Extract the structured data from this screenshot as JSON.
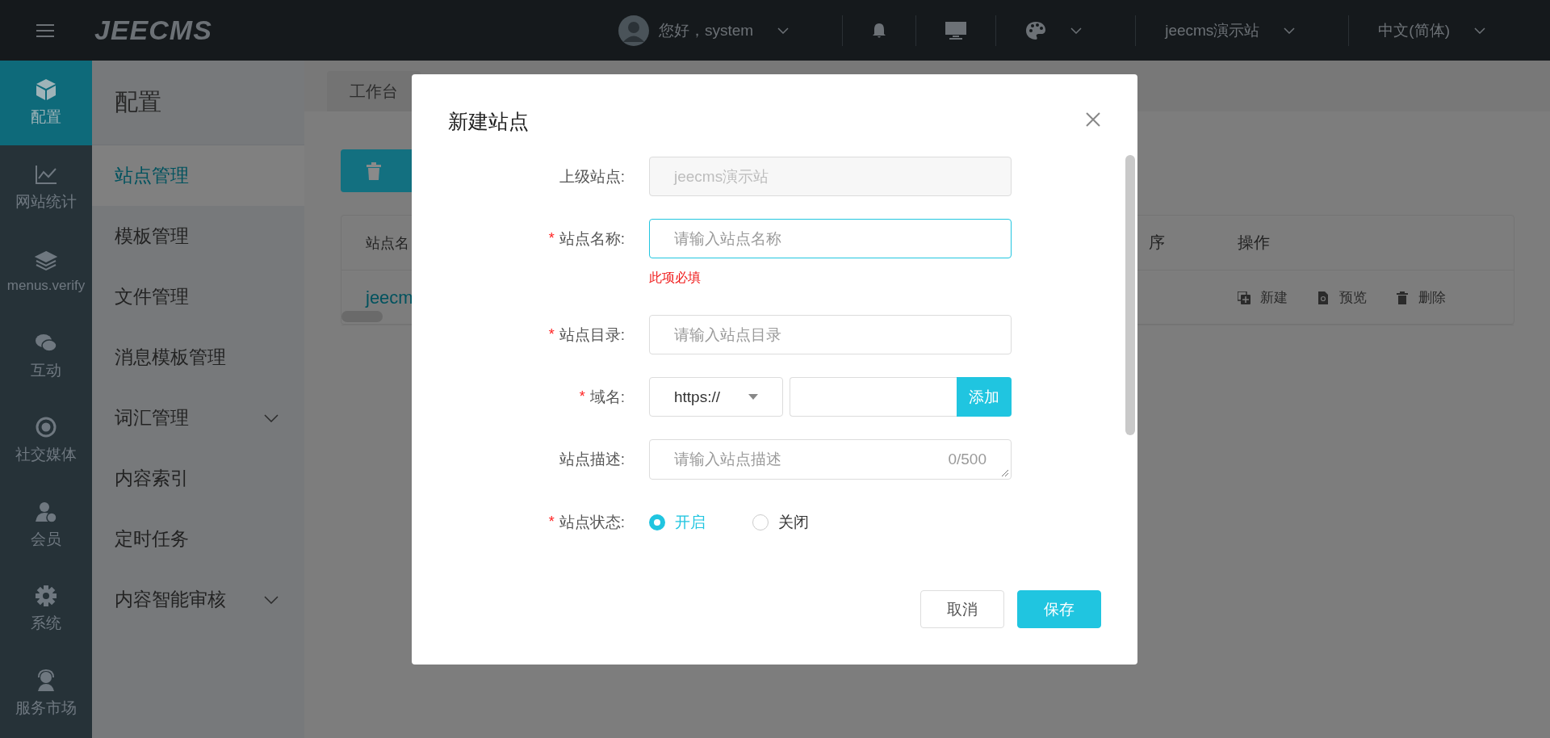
{
  "header": {
    "logo": "JEECMS",
    "greeting": "您好，system",
    "site": "jeecms演示站",
    "language": "中文(简体)"
  },
  "rail": [
    {
      "label": "配置",
      "selected": true
    },
    {
      "label": "网站统计",
      "selected": false
    },
    {
      "label": "menus.verify",
      "selected": false
    },
    {
      "label": "互动",
      "selected": false
    },
    {
      "label": "社交媒体",
      "selected": false
    },
    {
      "label": "会员",
      "selected": false
    },
    {
      "label": "系统",
      "selected": false
    },
    {
      "label": "服务市场",
      "selected": false
    }
  ],
  "sidebar": {
    "title": "配置",
    "items": [
      {
        "label": "站点管理",
        "selected": true,
        "expandable": false
      },
      {
        "label": "模板管理",
        "selected": false,
        "expandable": false
      },
      {
        "label": "文件管理",
        "selected": false,
        "expandable": false
      },
      {
        "label": "消息模板管理",
        "selected": false,
        "expandable": false
      },
      {
        "label": "词汇管理",
        "selected": false,
        "expandable": true
      },
      {
        "label": "内容索引",
        "selected": false,
        "expandable": false
      },
      {
        "label": "定时任务",
        "selected": false,
        "expandable": false
      },
      {
        "label": "内容智能审核",
        "selected": false,
        "expandable": true
      }
    ]
  },
  "tabs": [
    {
      "label": "工作台"
    }
  ],
  "table": {
    "columns": [
      "站点名",
      "序",
      "操作"
    ],
    "rows": [
      {
        "name": "jeecm",
        "actions": [
          {
            "kind": "new",
            "label": "新建"
          },
          {
            "kind": "preview",
            "label": "预览"
          },
          {
            "kind": "delete",
            "label": "删除"
          }
        ]
      }
    ]
  },
  "dialog": {
    "title": "新建站点",
    "fields": [
      {
        "kind": "readonly",
        "label": "上级站点:",
        "value": "jeecms演示站"
      },
      {
        "kind": "text",
        "required_mark": "*",
        "label": "站点名称:",
        "placeholder": "请输入站点名称",
        "focused": true,
        "error": "此项必填"
      },
      {
        "kind": "text",
        "required_mark": "*",
        "label": "站点目录:",
        "placeholder": "请输入站点目录",
        "focused": false
      },
      {
        "kind": "domain",
        "required_mark": "*",
        "label": "域名:",
        "protocol": "https://",
        "button": "添加"
      },
      {
        "kind": "textarea",
        "label": "站点描述:",
        "placeholder": "请输入站点描述",
        "counter": "0/500"
      },
      {
        "kind": "radio",
        "required_mark": "*",
        "label": "站点状态:",
        "options": [
          {
            "label": "开启",
            "selected": true
          },
          {
            "label": "关闭",
            "selected": false
          }
        ]
      }
    ],
    "buttons": [
      {
        "kind": "cancel",
        "label": "取消"
      },
      {
        "kind": "primary",
        "label": "保存"
      }
    ]
  }
}
